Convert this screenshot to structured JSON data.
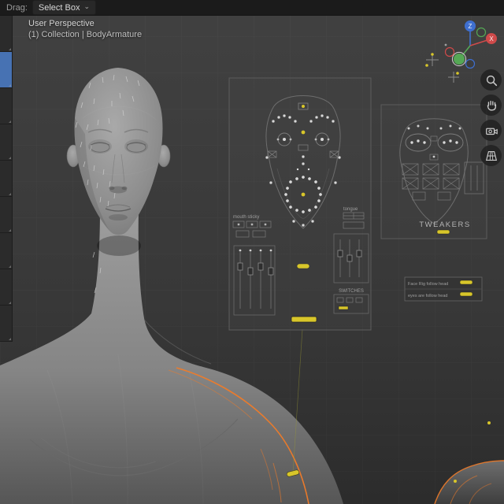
{
  "topbar": {
    "drag_label": "Drag:",
    "select_tool": "Select Box"
  },
  "icons": {
    "dropdown_caret": "⌄"
  },
  "viewport_overlay": {
    "view_label": "User Perspective",
    "collection_label": "(1) Collection | BodyArmature"
  },
  "gizmo": {
    "axis_z": "Z",
    "axis_x": "X"
  },
  "rig_panels": {
    "main": {
      "mouth_sticky_label": "mouth sticky",
      "tongue_label": "tongue",
      "switches_label": "SWITCHES"
    },
    "tweakers": {
      "title": "TWEAKERS",
      "follow_rows": [
        {
          "label": "Face Rig follow head"
        },
        {
          "label": "eyes are follow head"
        }
      ]
    }
  },
  "colors": {
    "accent_blue": "#4772b3",
    "selection_orange": "#f07b28",
    "control_yellow": "#d8c62a"
  }
}
